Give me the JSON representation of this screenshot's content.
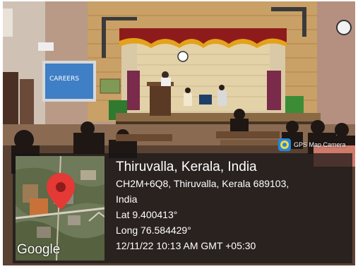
{
  "badge": {
    "label": "GPS Map Camera",
    "icon": "gps-map-camera-icon",
    "color": "#1e88e5"
  },
  "map": {
    "brand": "Google",
    "pin_color": "#e53935"
  },
  "location": {
    "title": "Thiruvalla, Kerala, India",
    "address_line1": "CH2M+6Q8, Thiruvalla, Kerala 689103,",
    "address_line2": "India",
    "latitude": "Lat 9.400413°",
    "longitude": "Long 76.584429°",
    "timestamp": "12/11/22 10:13 AM GMT +05:30"
  },
  "scene": {
    "banner_text": "CAREERS"
  }
}
